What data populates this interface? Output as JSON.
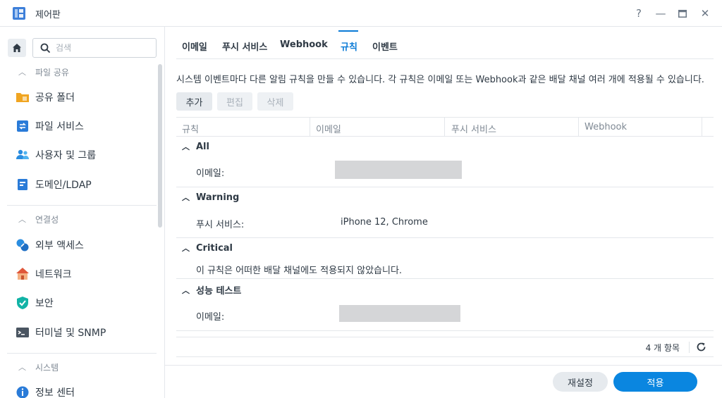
{
  "window": {
    "title": "제어판",
    "help": "?",
    "minimize": "—",
    "close": "✕"
  },
  "search": {
    "placeholder": "검색"
  },
  "sidebar": {
    "sections": [
      {
        "label": "파일 공유",
        "items": [
          "공유 폴더",
          "파일 서비스",
          "사용자 및 그룹",
          "도메인/LDAP"
        ]
      },
      {
        "label": "연결성",
        "items": [
          "외부 액세스",
          "네트워크",
          "보안",
          "터미널 및 SNMP"
        ]
      },
      {
        "label": "시스템",
        "items": [
          "정보 센터"
        ]
      }
    ]
  },
  "tabs": [
    "이메일",
    "푸시 서비스",
    "Webhook",
    "규칙",
    "이벤트"
  ],
  "active_tab": "규칙",
  "description": "시스템 이벤트마다 다른 알림 규칙을 만들 수 있습니다. 각 규칙은 이메일 또는 Webhook과 같은 배달 채널 여러 개에 적용될 수 있습니다.",
  "toolbar": {
    "add": "추가",
    "edit": "편집",
    "delete": "삭제"
  },
  "columns": [
    "규칙",
    "이메일",
    "푸시 서비스",
    "Webhook"
  ],
  "groups": [
    {
      "title": "All",
      "label": "이메일:",
      "value": ""
    },
    {
      "title": "Warning",
      "label": "푸시 서비스:",
      "value": "iPhone 12, Chrome"
    },
    {
      "title": "Critical",
      "label": "이 규칙은 어떠한 배달 채널에도 적용되지 않았습니다.",
      "value": ""
    },
    {
      "title": "성능 테스트",
      "label": "이메일:",
      "value": ""
    }
  ],
  "footer": {
    "count": "4 개 항목"
  },
  "actions": {
    "reset": "재설정",
    "apply": "적용"
  },
  "colors": {
    "accent": "#0a7ad6",
    "apply_button": "#0a86e0"
  }
}
